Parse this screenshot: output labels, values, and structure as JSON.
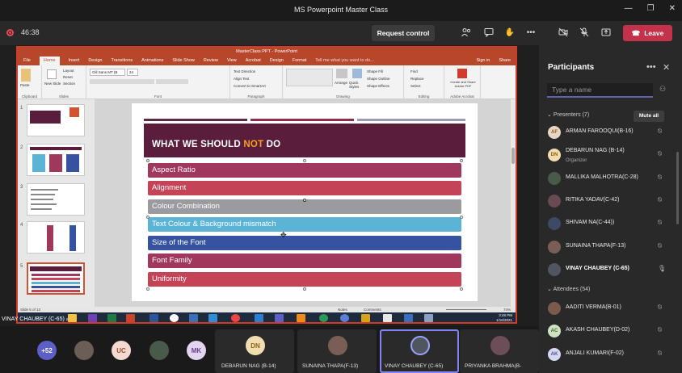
{
  "window": {
    "title": "MS Powerpoint Master Class",
    "controls": [
      "—",
      "❐",
      "✕"
    ]
  },
  "meeting": {
    "timer": "46:38",
    "request_control_label": "Request control",
    "leave_label": "Leave",
    "toolbar_icons": [
      "participants-icon",
      "chat-icon",
      "raise-hand-icon",
      "more-icon",
      "camera-off-icon",
      "mic-off-icon",
      "share-icon"
    ]
  },
  "powerpoint": {
    "window_title": "MasterClass PPT - PowerPoint",
    "tabs": [
      "File",
      "Home",
      "Insert",
      "Design",
      "Transitions",
      "Animations",
      "Slide Show",
      "Review",
      "View",
      "Acrobat",
      "Design",
      "Format"
    ],
    "tell_me": "Tell me what you want to do...",
    "sign_in": "Sign in",
    "share": "Share",
    "font_name": "Gill Sans MT (B",
    "font_size": "24",
    "ribbon_groups": [
      "Clipboard",
      "Slides",
      "Font",
      "Paragraph",
      "Drawing",
      "Editing",
      "Adobe Acrobat"
    ],
    "ribbon_buttons": [
      "Paste",
      "New Slide",
      "Layout",
      "Reset",
      "Section",
      "Text Direction",
      "Align Text",
      "Convert to SmartArt",
      "Arrange",
      "Quick Styles",
      "Shape Fill",
      "Shape Outline",
      "Shape Effects",
      "Find",
      "Replace",
      "Select",
      "Create and Share Adobe PDF"
    ],
    "slide_numbers": [
      "1",
      "2",
      "3",
      "4",
      "5"
    ],
    "status_left": "Slide 5 of 13",
    "status_notes": "Notes",
    "status_comments": "Comments",
    "zoom": "74%",
    "clock_time": "3:45 PM",
    "clock_date": "1/16/2021"
  },
  "slide": {
    "title_prefix": "WHAT WE SHOULD ",
    "title_highlight": "NOT",
    "title_suffix": " DO",
    "items": [
      {
        "label": "Aspect Ratio",
        "color": "#a0375c"
      },
      {
        "label": "Alignment",
        "color": "#c44356"
      },
      {
        "label": "Colour Combination",
        "color": "#9a9a9f"
      },
      {
        "label": "Text Colour & Background mismatch",
        "color": "#5bb4d6"
      },
      {
        "label": "Size of the Font",
        "color": "#3553a0"
      },
      {
        "label": "Font Family",
        "color": "#a0375c"
      },
      {
        "label": "Uniformity",
        "color": "#c44356"
      }
    ],
    "colors": {
      "header": "#5a1d3c",
      "highlight": "#f5a31a"
    }
  },
  "presenter_label": "VINAY CHAUBEY (C-65)",
  "participants": {
    "heading": "Participants",
    "search_placeholder": "Type a name",
    "presenters_label": "Presenters (7)",
    "mute_all_label": "Mute all",
    "attendees_label": "Attendees (54)",
    "presenters": [
      {
        "initials": "AF",
        "name": "ARMAN FAROOQUI(B-16)",
        "role": "",
        "avatar_bg": "#e8d6c2",
        "avatar_fg": "#8a5a2b",
        "photo": false
      },
      {
        "initials": "DN",
        "name": "DEBARUN NAG (B-14)",
        "role": "Organizer",
        "avatar_bg": "#f2ddb0",
        "avatar_fg": "#8a6414",
        "photo": false
      },
      {
        "initials": "",
        "name": "MALLIKA MALHOTRA(C-28)",
        "role": "",
        "avatar_bg": "#4a5a4a",
        "avatar_fg": "#fff",
        "photo": true
      },
      {
        "initials": "",
        "name": "RITIKA YADAV(C-42)",
        "role": "",
        "avatar_bg": "#6a4a52",
        "avatar_fg": "#fff",
        "photo": true
      },
      {
        "initials": "",
        "name": "SHIVAM NA(C-44))",
        "role": "",
        "avatar_bg": "#3c4a66",
        "avatar_fg": "#fff",
        "photo": true
      },
      {
        "initials": "",
        "name": "SUNAINA THAPA(F-13)",
        "role": "",
        "avatar_bg": "#7a5e55",
        "avatar_fg": "#fff",
        "photo": true
      },
      {
        "initials": "",
        "name": "VINAY CHAUBEY (C-65)",
        "role": "",
        "avatar_bg": "#4f5660",
        "avatar_fg": "#fff",
        "photo": true
      }
    ],
    "attendees": [
      {
        "initials": "",
        "name": "AADITI VERMA(B-01)",
        "avatar_bg": "#7a5a4a",
        "avatar_fg": "#fff",
        "photo": true
      },
      {
        "initials": "AC",
        "name": "AKASH CHAUBEY(D-02)",
        "avatar_bg": "#cfe3c2",
        "avatar_fg": "#3b6b2a",
        "photo": false
      },
      {
        "initials": "AK",
        "name": "ANJALI KUMARI(F-02)",
        "avatar_bg": "#d6d8f2",
        "avatar_fg": "#4a4f9a",
        "photo": false
      }
    ]
  },
  "gallery": {
    "overflow_count": "+52",
    "avatars": [
      {
        "initials": "UC",
        "bg": "#f4d9d0",
        "fg": "#9a4a33"
      },
      {
        "initials": "MK",
        "bg": "#e3d4f0",
        "fg": "#6a3e8a"
      }
    ],
    "tiles": [
      {
        "initials": "DN",
        "name": "DEBARUN NAG (B-14)",
        "bg": "#f2ddb0",
        "fg": "#8a6414"
      },
      {
        "initials": "",
        "name": "SUNAINA THAPA(F-13)",
        "bg": "#7a5e55",
        "fg": "#fff"
      },
      {
        "initials": "",
        "name": "VINAY CHAUBEY (C-65)",
        "bg": "#4f5660",
        "fg": "#fff"
      },
      {
        "initials": "",
        "name": "PRIYANKA BRAHMA(B-",
        "bg": "#6b4e58",
        "fg": "#fff"
      }
    ]
  }
}
